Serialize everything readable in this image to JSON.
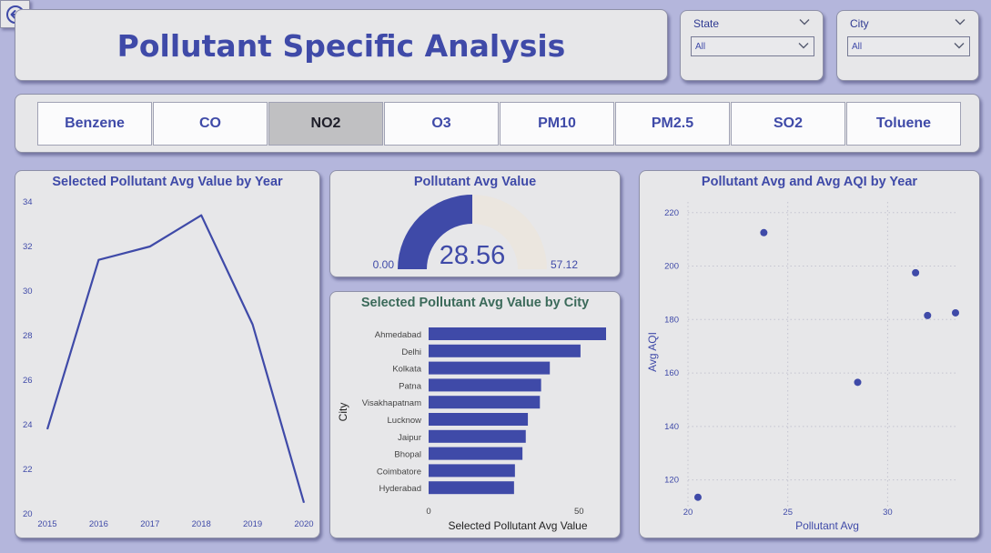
{
  "header": {
    "title": "Pollutant Specific Analysis"
  },
  "slicers": {
    "state": {
      "label": "State",
      "value": "All"
    },
    "city": {
      "label": "City",
      "value": "All"
    }
  },
  "tabs": [
    {
      "label": "Benzene",
      "active": false
    },
    {
      "label": "CO",
      "active": false
    },
    {
      "label": "NO2",
      "active": true
    },
    {
      "label": "O3",
      "active": false
    },
    {
      "label": "PM10",
      "active": false
    },
    {
      "label": "PM2.5",
      "active": false
    },
    {
      "label": "SO2",
      "active": false
    },
    {
      "label": "Toluene",
      "active": false
    }
  ],
  "colors": {
    "accent": "#3f4aa8",
    "gauge_track": "#ebe6df",
    "panel": "#e7e7e9",
    "background": "#b4b6dc"
  },
  "icons": {
    "back": "back-arrow-icon",
    "dropdown": "chevron-down-icon"
  },
  "chart_data": [
    {
      "type": "line",
      "title": "Selected Pollutant Avg Value by Year",
      "x": [
        "2015",
        "2016",
        "2017",
        "2018",
        "2019",
        "2020"
      ],
      "values": [
        23.8,
        31.4,
        32.0,
        33.4,
        28.5,
        20.5
      ],
      "yticks": [
        20,
        22,
        24,
        26,
        28,
        30,
        32,
        34
      ],
      "ylim": [
        20,
        34
      ],
      "xlabel": "",
      "ylabel": ""
    },
    {
      "type": "gauge",
      "title": "Pollutant Avg Value",
      "value": 28.56,
      "value_label": "28.56",
      "min": 0,
      "max": 57.12,
      "min_label": "0.00",
      "max_label": "57.12"
    },
    {
      "type": "bar",
      "orientation": "horizontal",
      "title": "Selected Pollutant Avg Value by City",
      "categories": [
        "Ahmedabad",
        "Delhi",
        "Kolkata",
        "Patna",
        "Visakhapatnam",
        "Lucknow",
        "Jaipur",
        "Bhopal",
        "Coimbatore",
        "Hyderabad"
      ],
      "values": [
        59.0,
        50.5,
        40.3,
        37.4,
        37.0,
        33.0,
        32.3,
        31.2,
        28.7,
        28.4
      ],
      "xlabel": "Selected Pollutant Avg Value",
      "ylabel": "City",
      "xticks": [
        0,
        50
      ],
      "xlim": [
        0,
        59
      ]
    },
    {
      "type": "scatter",
      "title": "Pollutant Avg and Avg AQI by Year",
      "points": [
        {
          "x": 20.5,
          "y": 113.5
        },
        {
          "x": 23.8,
          "y": 212.5
        },
        {
          "x": 28.5,
          "y": 156.5
        },
        {
          "x": 31.4,
          "y": 197.5
        },
        {
          "x": 32.0,
          "y": 181.5
        },
        {
          "x": 33.4,
          "y": 182.5
        }
      ],
      "xlabel": "Pollutant Avg",
      "ylabel": "Avg AQI",
      "xticks": [
        20,
        25,
        30
      ],
      "yticks": [
        120,
        140,
        160,
        180,
        200,
        220
      ],
      "xlim": [
        20,
        33.4
      ],
      "ylim": [
        110,
        224
      ],
      "grid": true
    }
  ]
}
